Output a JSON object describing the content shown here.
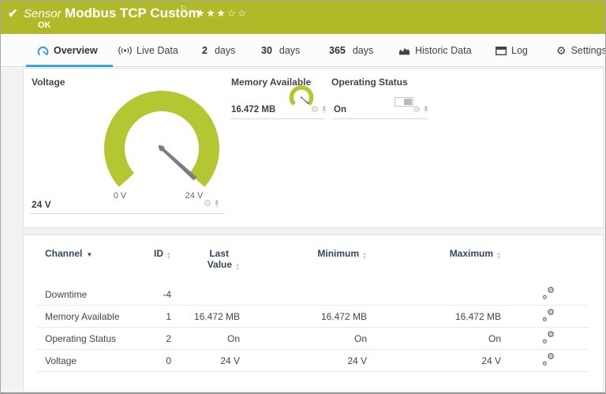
{
  "colors": {
    "header_green": "#b0ba29",
    "gauge_green": "#b4c732",
    "accent_blue": "#31a7de",
    "needle_gray": "#7d7d7d"
  },
  "icons": {
    "status_check": "✔",
    "flag": "⚐",
    "gear": "⚙",
    "sort_asc": "▲",
    "sort_desc": "▼"
  },
  "header": {
    "kind_label": "Sensor",
    "title": "Modbus TCP Custom",
    "status": "OK",
    "stars": "★★★☆☆"
  },
  "tabs": {
    "overview": "Overview",
    "live_data": "Live Data",
    "d2_num": "2",
    "d2_label": "days",
    "d30_num": "30",
    "d30_label": "days",
    "d365_num": "365",
    "d365_label": "days",
    "historic": "Historic Data",
    "log": "Log",
    "settings": "Settings"
  },
  "gauges": {
    "voltage": {
      "title": "Voltage",
      "value": "24 V",
      "scale_min": "0 V",
      "scale_max": "24 V"
    },
    "memory": {
      "title": "Memory Available",
      "value": "16.472 MB"
    },
    "operating": {
      "title": "Operating Status",
      "value": "On"
    }
  },
  "table": {
    "headers": {
      "channel": "Channel",
      "id": "ID",
      "last_line1": "Last",
      "last_line2": "Value",
      "min": "Minimum",
      "max": "Maximum"
    },
    "rows": [
      {
        "channel": "Downtime",
        "id": "-4",
        "last": "",
        "min": "",
        "max": ""
      },
      {
        "channel": "Memory Available",
        "id": "1",
        "last": "16.472 MB",
        "min": "16.472 MB",
        "max": "16.472 MB"
      },
      {
        "channel": "Operating Status",
        "id": "2",
        "last": "On",
        "min": "On",
        "max": "On"
      },
      {
        "channel": "Voltage",
        "id": "0",
        "last": "24 V",
        "min": "24 V",
        "max": "24 V"
      }
    ]
  }
}
